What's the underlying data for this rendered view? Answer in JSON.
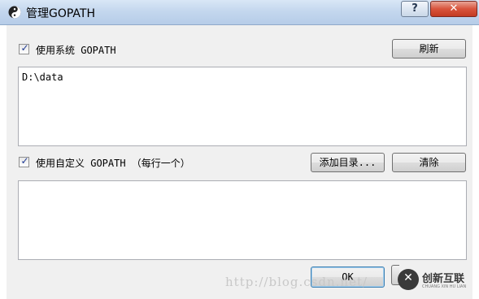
{
  "window": {
    "title": "管理GOPATH",
    "help_label": "?",
    "close_label": "✕"
  },
  "system_gopath": {
    "checkbox_label": "使用系统 GOPATH",
    "checked": true,
    "refresh_label": "刷新",
    "value": "D:\\data"
  },
  "custom_gopath": {
    "checkbox_label": "使用自定义 GOPATH （每行一个）",
    "checked": true,
    "add_dir_label": "添加目录...",
    "clear_label": "清除",
    "value": ""
  },
  "footer": {
    "ok_label": "OK",
    "watermark": "http://blog.csdn.net/",
    "logo_text": "创新互联",
    "logo_subtext": "CHUANG XIN HU LIAN"
  },
  "colors": {
    "titlebar": "#c4d7ee",
    "dialog_bg": "#f0f0f0",
    "close_button": "#d8543c",
    "default_button_border": "#3c7fb1"
  }
}
